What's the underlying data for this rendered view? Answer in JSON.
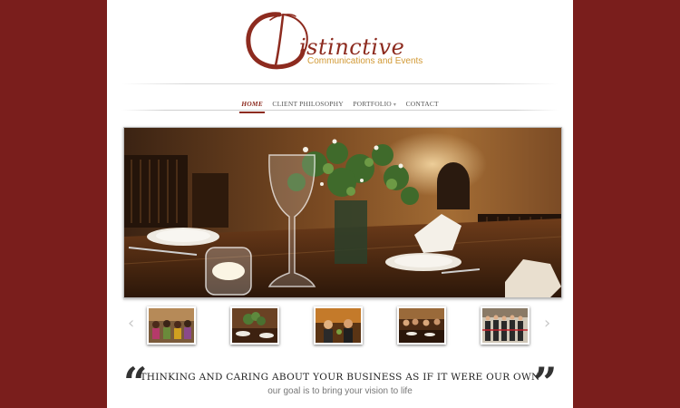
{
  "logo": {
    "brand": "istinctive",
    "tagline": "Communications and Events"
  },
  "nav": {
    "items": [
      {
        "label": "HOME",
        "active": true
      },
      {
        "label": "CLIENT PHILOSOPHY",
        "active": false
      },
      {
        "label": "PORTFOLIO",
        "active": false,
        "has_submenu": true
      },
      {
        "label": "CONTACT",
        "active": false
      }
    ]
  },
  "slider": {
    "prev_icon": "chevron-left-icon",
    "next_icon": "chevron-right-icon",
    "prev_glyph": "‹",
    "next_glyph": "›",
    "thumbnail_count": 5
  },
  "quote": {
    "open_mark": "“",
    "close_mark": "”",
    "headline": "THINKING AND CARING ABOUT YOUR BUSINESS AS IF IT WERE OUR OWN",
    "subline": "our goal is to bring your vision to life"
  },
  "colors": {
    "background": "#7a1e1c",
    "brand": "#8d2b1f",
    "tagline": "#d29a36"
  }
}
